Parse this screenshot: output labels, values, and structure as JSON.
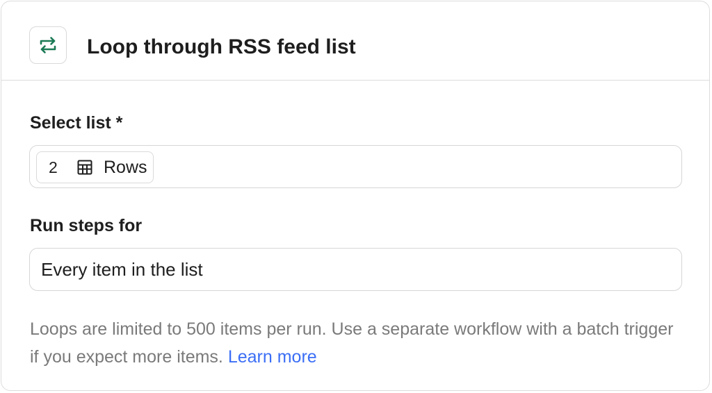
{
  "header": {
    "title": "Loop through RSS feed list",
    "icon": "loop-arrows-icon",
    "icon_color": "#1b7a55"
  },
  "select_list": {
    "label": "Select list *",
    "chip": {
      "count": "2",
      "icon": "table-icon",
      "label": "Rows"
    }
  },
  "run_steps": {
    "label": "Run steps for",
    "value": "Every item in the list"
  },
  "helper": {
    "text": "Loops are limited to 500 items per run. Use a separate workflow with a batch trigger if you expect more items.",
    "link_label": "Learn more",
    "link_color": "#3b6ef5"
  }
}
